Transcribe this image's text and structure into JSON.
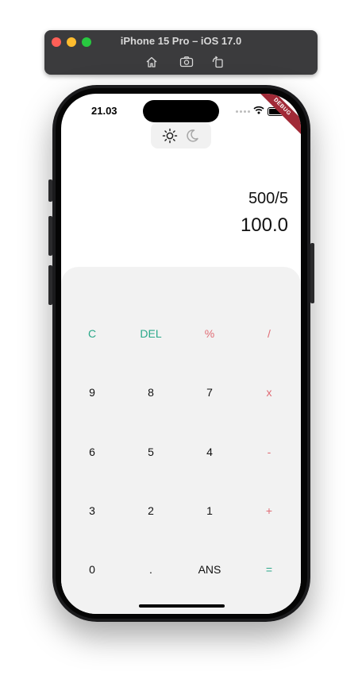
{
  "simulator": {
    "title": "iPhone 15 Pro – iOS 17.0",
    "icons": [
      "home-icon",
      "screenshot-icon",
      "rotate-icon"
    ]
  },
  "status_bar": {
    "time": "21.03",
    "debug_label": "DEBUG"
  },
  "theme_toggle": {
    "options": [
      "light-sun-icon",
      "dark-moon-icon"
    ],
    "active": "light"
  },
  "display": {
    "expression": "500/5",
    "result": "100.0"
  },
  "colors": {
    "function_key": "#2aa889",
    "operator_key": "#e06b74",
    "digit_key": "#111111",
    "keypad_bg": "#f2f2f2"
  },
  "keypad": {
    "rows": [
      [
        "C",
        "DEL",
        "%",
        "/"
      ],
      [
        "9",
        "8",
        "7",
        "x"
      ],
      [
        "6",
        "5",
        "4",
        "-"
      ],
      [
        "3",
        "2",
        "1",
        "+"
      ],
      [
        "0",
        ".",
        "ANS",
        "="
      ]
    ]
  }
}
